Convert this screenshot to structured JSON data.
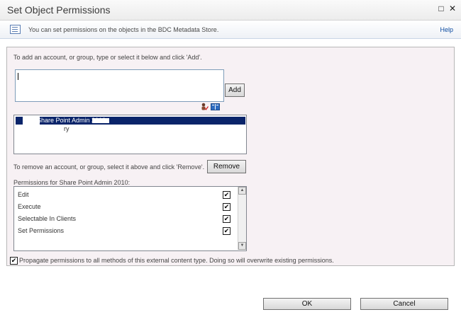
{
  "dialog": {
    "title": "Set Object Permissions",
    "maximize_glyph": "□",
    "close_glyph": "✕"
  },
  "info": {
    "text": "You can set permissions on the objects in the BDC Metadata Store.",
    "help_label": "Help"
  },
  "add": {
    "instruction": "To add an account, or group, type or select it below and click 'Add'.",
    "input_value": "",
    "button_label": "Add"
  },
  "accounts": {
    "items": [
      {
        "label": "Share Point Admin 2010",
        "selected": true
      },
      {
        "label": "ry",
        "selected": false
      }
    ]
  },
  "remove": {
    "instruction": "To remove an account, or group, select it above and click 'Remove'.",
    "button_label": "Remove"
  },
  "permissions": {
    "heading": "Permissions for Share Point Admin 2010:",
    "items": [
      {
        "label": "Edit",
        "checked": true
      },
      {
        "label": "Execute",
        "checked": true
      },
      {
        "label": "Selectable In Clients",
        "checked": true
      },
      {
        "label": "Set Permissions",
        "checked": true
      }
    ]
  },
  "propagate": {
    "label": "Propagate permissions to all methods of this external content type. Doing so will overwrite existing permissions.",
    "checked": true
  },
  "footer": {
    "ok_label": "OK",
    "cancel_label": "Cancel"
  }
}
